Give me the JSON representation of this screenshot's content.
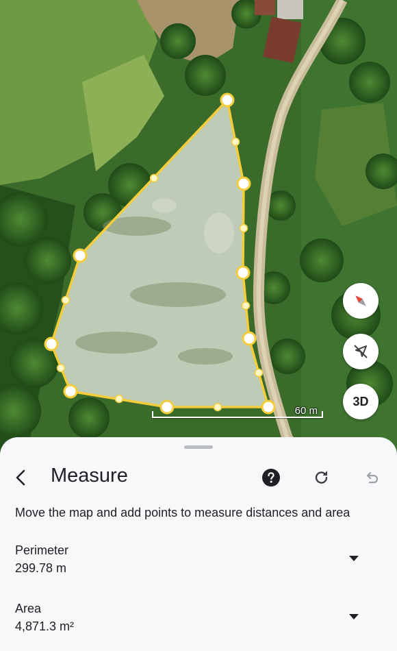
{
  "map": {
    "scale_label": "60 m",
    "buttons": {
      "compass": "compass-icon",
      "recenter": "location-off-icon",
      "toggle_3d": "3D"
    },
    "colors": {
      "measure_line": "#f3cd3a",
      "polygon_fill": "#ffffff"
    }
  },
  "sheet": {
    "title": "Measure",
    "instruction": "Move the map and add points to measure distances and area",
    "icons": {
      "back": "back-arrow-icon",
      "help": "help-icon",
      "redo": "redo-icon",
      "undo": "undo-icon"
    },
    "perimeter": {
      "label": "Perimeter",
      "value": "299.78 m"
    },
    "area": {
      "label": "Area",
      "value": "4,871.3 m²"
    }
  }
}
